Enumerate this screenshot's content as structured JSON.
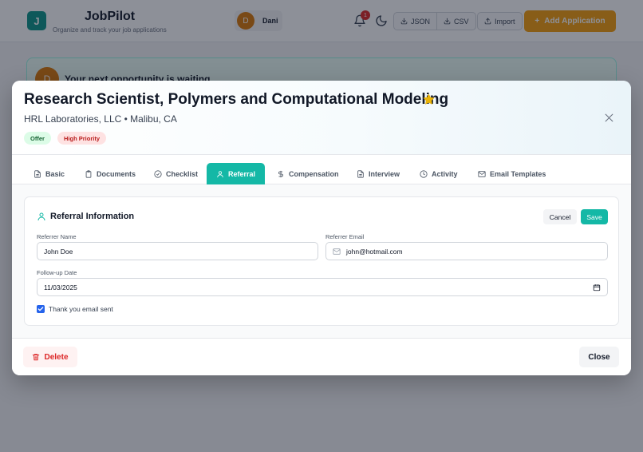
{
  "app": {
    "logo_letter": "J",
    "name": "JobPilot",
    "tagline": "Organize and track your job applications",
    "user_initial": "D",
    "user_name": "Dani",
    "notification_count": "1",
    "export_json_label": "JSON",
    "export_csv_label": "CSV",
    "import_label": "Import",
    "add_button_label": "Add Application",
    "banner_initial": "D",
    "banner_text": "Your next opportunity is waiting"
  },
  "modal": {
    "title": "Research Scientist, Polymers and Computational Modeling",
    "company_line": "HRL Laboratories, LLC • Malibu, CA",
    "favorited": true,
    "badges": [
      "Offer",
      "High Priority"
    ],
    "tabs": [
      {
        "label": "Basic",
        "icon": "document-icon"
      },
      {
        "label": "Documents",
        "icon": "clipboard-icon"
      },
      {
        "label": "Checklist",
        "icon": "check-circle-icon"
      },
      {
        "label": "Referral",
        "icon": "user-icon",
        "active": true
      },
      {
        "label": "Compensation",
        "icon": "dollar-icon"
      },
      {
        "label": "Interview",
        "icon": "document-icon"
      },
      {
        "label": "Activity",
        "icon": "clock-icon"
      },
      {
        "label": "Email Templates",
        "icon": "mail-icon"
      }
    ],
    "section": {
      "title": "Referral Information",
      "cancel_label": "Cancel",
      "save_label": "Save",
      "referrer_name_label": "Referrer Name",
      "referrer_name_value": "John Doe",
      "referrer_email_label": "Referrer Email",
      "referrer_email_value": "john@hotmail.com",
      "followup_label": "Follow-up Date",
      "followup_value": "11/03/2025",
      "thank_you_label": "Thank you email sent",
      "thank_you_checked": true
    },
    "delete_label": "Delete",
    "close_label": "Close"
  },
  "colors": {
    "accent": "#14b8a6",
    "primary_button": "#f59e0b",
    "star": "#eab308",
    "danger": "#dc2626"
  }
}
